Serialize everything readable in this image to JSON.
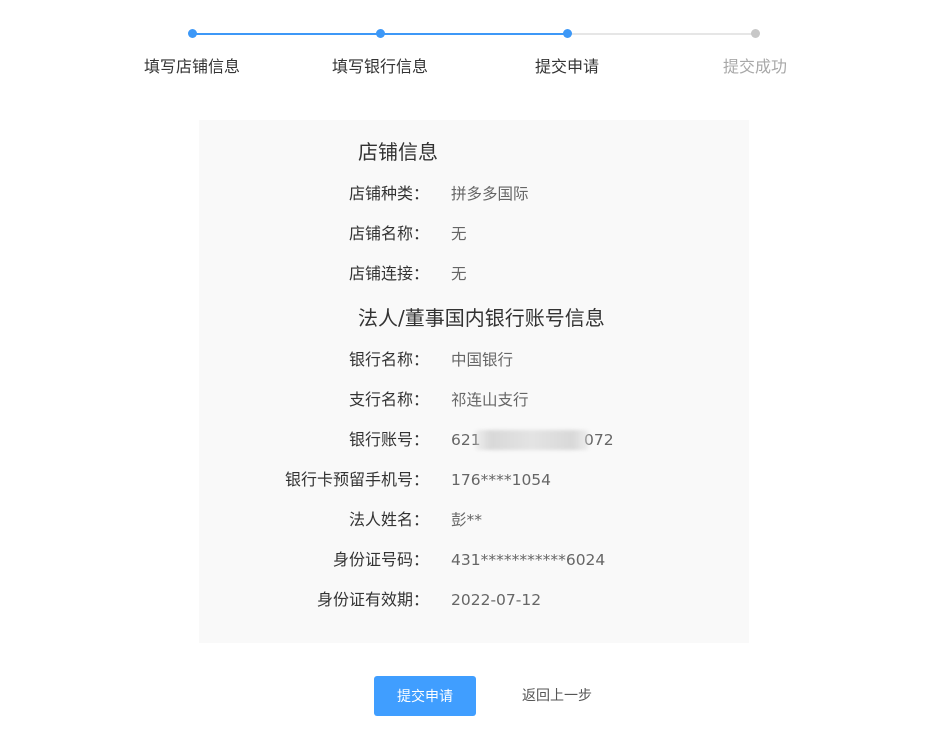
{
  "stepper": {
    "steps": [
      {
        "label": "填写店铺信息",
        "status": "done"
      },
      {
        "label": "填写银行信息",
        "status": "done"
      },
      {
        "label": "提交申请",
        "status": "current"
      },
      {
        "label": "提交成功",
        "status": "pending"
      }
    ],
    "colors": {
      "active": "#3d98f7",
      "pending": "#c7c7c7"
    }
  },
  "shop_section": {
    "title": "店铺信息",
    "rows": [
      {
        "label": "店铺种类：",
        "value": "拼多多国际"
      },
      {
        "label": "店铺名称：",
        "value": "无"
      },
      {
        "label": "店铺连接：",
        "value": "无"
      }
    ]
  },
  "bank_section": {
    "title": "法人/董事国内银行账号信息",
    "rows": [
      {
        "label": "银行名称：",
        "value": "中国银行"
      },
      {
        "label": "支行名称：",
        "value": "祁连山支行"
      },
      {
        "label": "银行账号：",
        "value": "621",
        "value_end": "072"
      },
      {
        "label": "银行卡预留手机号：",
        "value": "176****1054"
      },
      {
        "label": "法人姓名：",
        "value": "彭**"
      },
      {
        "label": "身份证号码：",
        "value": "431***********6024"
      },
      {
        "label": "身份证有效期：",
        "value": "2022-07-12"
      }
    ]
  },
  "actions": {
    "submit_label": "提交申请",
    "back_label": "返回上一步",
    "primary_color": "#409eff"
  }
}
